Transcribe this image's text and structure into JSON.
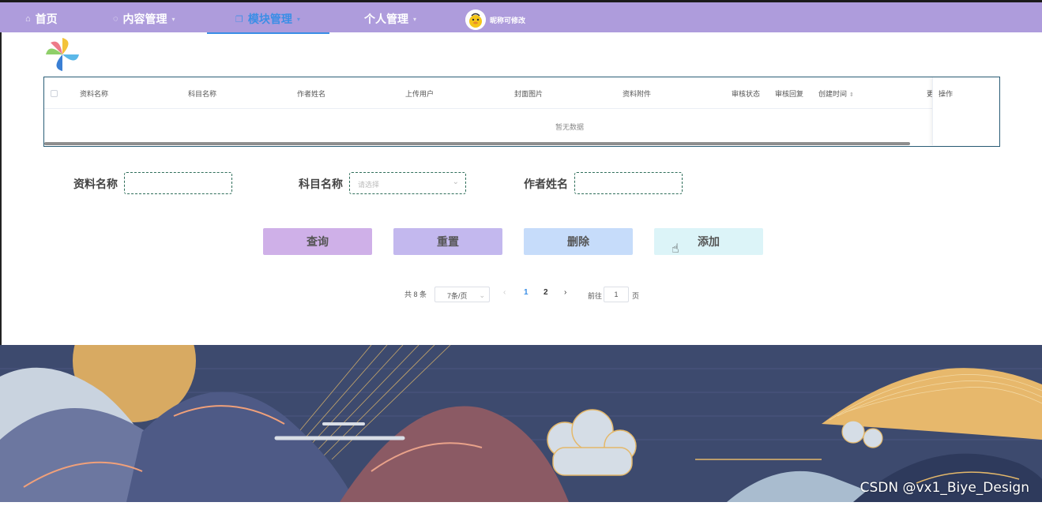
{
  "nav": {
    "home": "首页",
    "content": "内容管理",
    "module": "模块管理",
    "personal": "个人管理",
    "nickname": "昵称可修改"
  },
  "table": {
    "columns": [
      "资料名称",
      "科目名称",
      "作者姓名",
      "上传用户",
      "封面图片",
      "资料附件",
      "审核状态",
      "审核回复",
      "创建时间",
      "更",
      "操作"
    ],
    "empty_text": "暂无数据"
  },
  "search": {
    "name_label": "资料名称",
    "name_value": "",
    "subject_label": "科目名称",
    "subject_placeholder": "请选择",
    "author_label": "作者姓名",
    "author_value": ""
  },
  "buttons": {
    "query": "查询",
    "reset": "重置",
    "delete": "删除",
    "add": "添加"
  },
  "pagination": {
    "total": "共 8 条",
    "page_size": "7条/页",
    "pages": [
      "1",
      "2"
    ],
    "goto_prefix": "前往",
    "goto_value": "1",
    "goto_suffix": "页"
  },
  "watermark": "CSDN @vx1_Biye_Design",
  "colors": {
    "topbar": "#ae9cdc",
    "active": "#3a8ee6",
    "btn_query": "#cfb0e8",
    "btn_reset": "#c3b8ee",
    "btn_delete": "#c6dcfa",
    "btn_add": "#dcf4f8"
  }
}
